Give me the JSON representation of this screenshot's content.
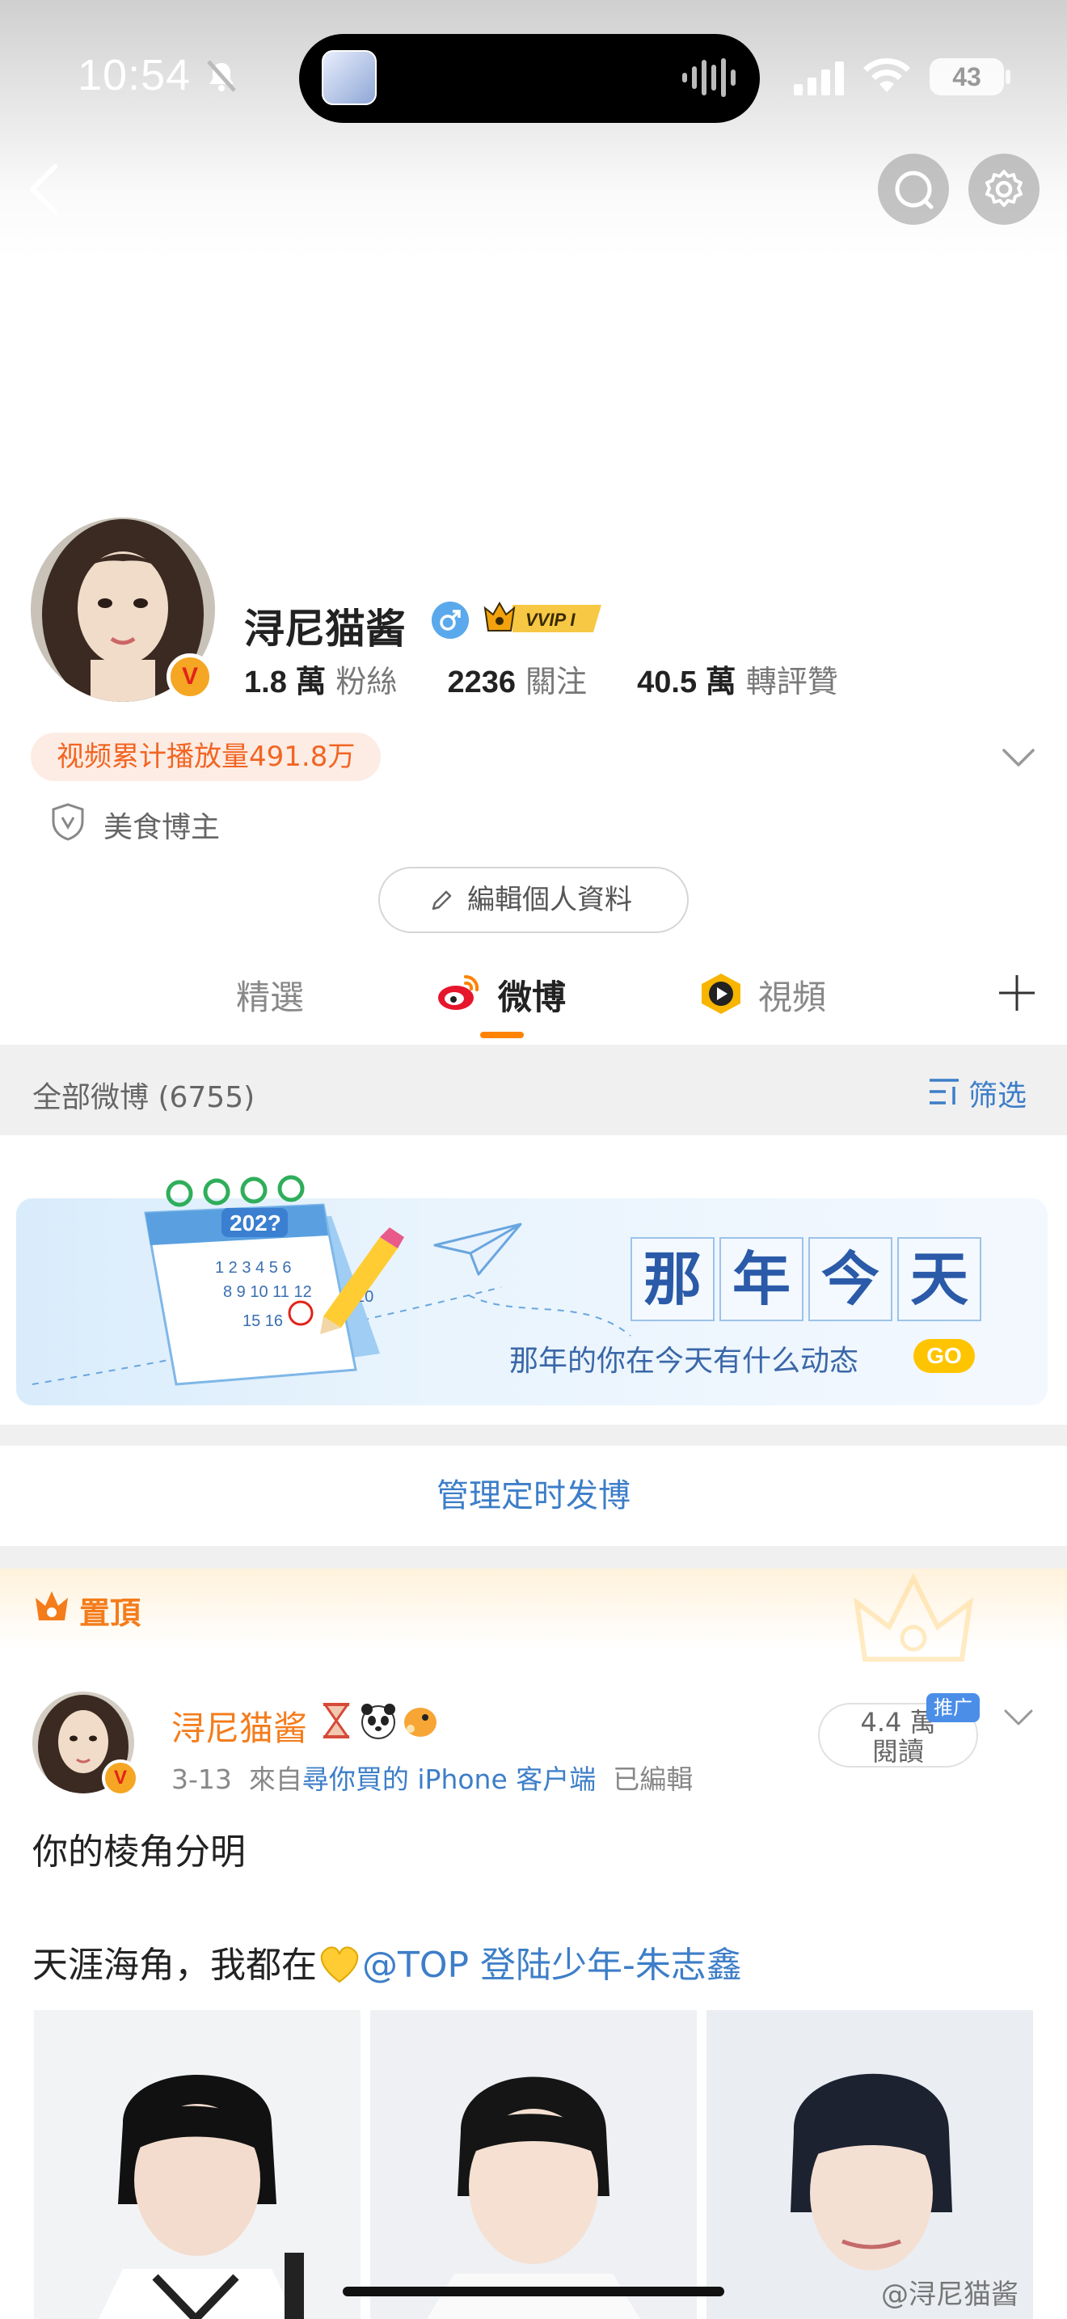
{
  "status_bar": {
    "time": "10:54",
    "battery": "43"
  },
  "profile": {
    "name": "浔尼猫酱",
    "vip_label": "VVIP I",
    "stats": [
      {
        "value": "1.8 萬",
        "label": "粉絲"
      },
      {
        "value": "2236",
        "label": "關注"
      },
      {
        "value": "40.5 萬",
        "label": "轉評贊"
      }
    ],
    "play_count": "视频累计播放量491.8万",
    "tag": "美食博主",
    "edit_button": "編輯個人資料"
  },
  "tabs": [
    {
      "label": "精選",
      "active": false
    },
    {
      "label": "微博",
      "active": true
    },
    {
      "label": "視頻",
      "active": false
    }
  ],
  "filter": {
    "count_label": "全部微博 (6755)",
    "filter_label": "筛选"
  },
  "banner": {
    "title_chars": [
      "那",
      "年",
      "今",
      "天"
    ],
    "subtitle": "那年的你在今天有什么动态",
    "go_label": "GO",
    "calendar_year": "202?"
  },
  "manage_label": "管理定时发博",
  "pinned": {
    "label": "置頂",
    "author": "浔尼猫酱",
    "date": "3-13",
    "source_prefix": "來自",
    "source": "尋你買的 iPhone 客户端",
    "edited": "已編輯",
    "reads_value": "4.4 萬",
    "reads_label": "閱讀",
    "promo_label": "推广",
    "text_line1": "你的棱角分明",
    "text_line2_prefix": "天涯海角，我都在",
    "mention": "@TOP 登陆少年-朱志鑫"
  },
  "watermark": "@浔尼猫酱",
  "colors": {
    "accent_orange": "#ff8200",
    "link_blue": "#3d7ec8",
    "name_orange": "#f47c1b"
  }
}
